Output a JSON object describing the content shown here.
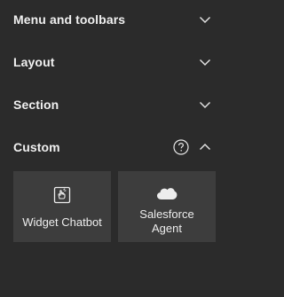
{
  "sections": [
    {
      "title": "Menu and toolbars",
      "state": "collapsed",
      "chevron_icon": "chevron-down-icon"
    },
    {
      "title": "Layout",
      "state": "collapsed",
      "chevron_icon": "chevron-down-icon"
    },
    {
      "title": "Section",
      "state": "collapsed",
      "chevron_icon": "chevron-down-icon"
    },
    {
      "title": "Custom",
      "state": "expanded",
      "chevron_icon": "chevron-up-icon",
      "help_icon": "help-circle-icon"
    }
  ],
  "custom_widgets": [
    {
      "label": "Widget Chatbot",
      "icon": "chatbot-icon"
    },
    {
      "label_line1": "Salesforce",
      "label_line2": "Agent",
      "icon": "salesforce-cloud-icon"
    }
  ],
  "colors": {
    "background": "#2b2b2b",
    "tile": "#3d3d3d",
    "text": "#f0f0f0"
  }
}
